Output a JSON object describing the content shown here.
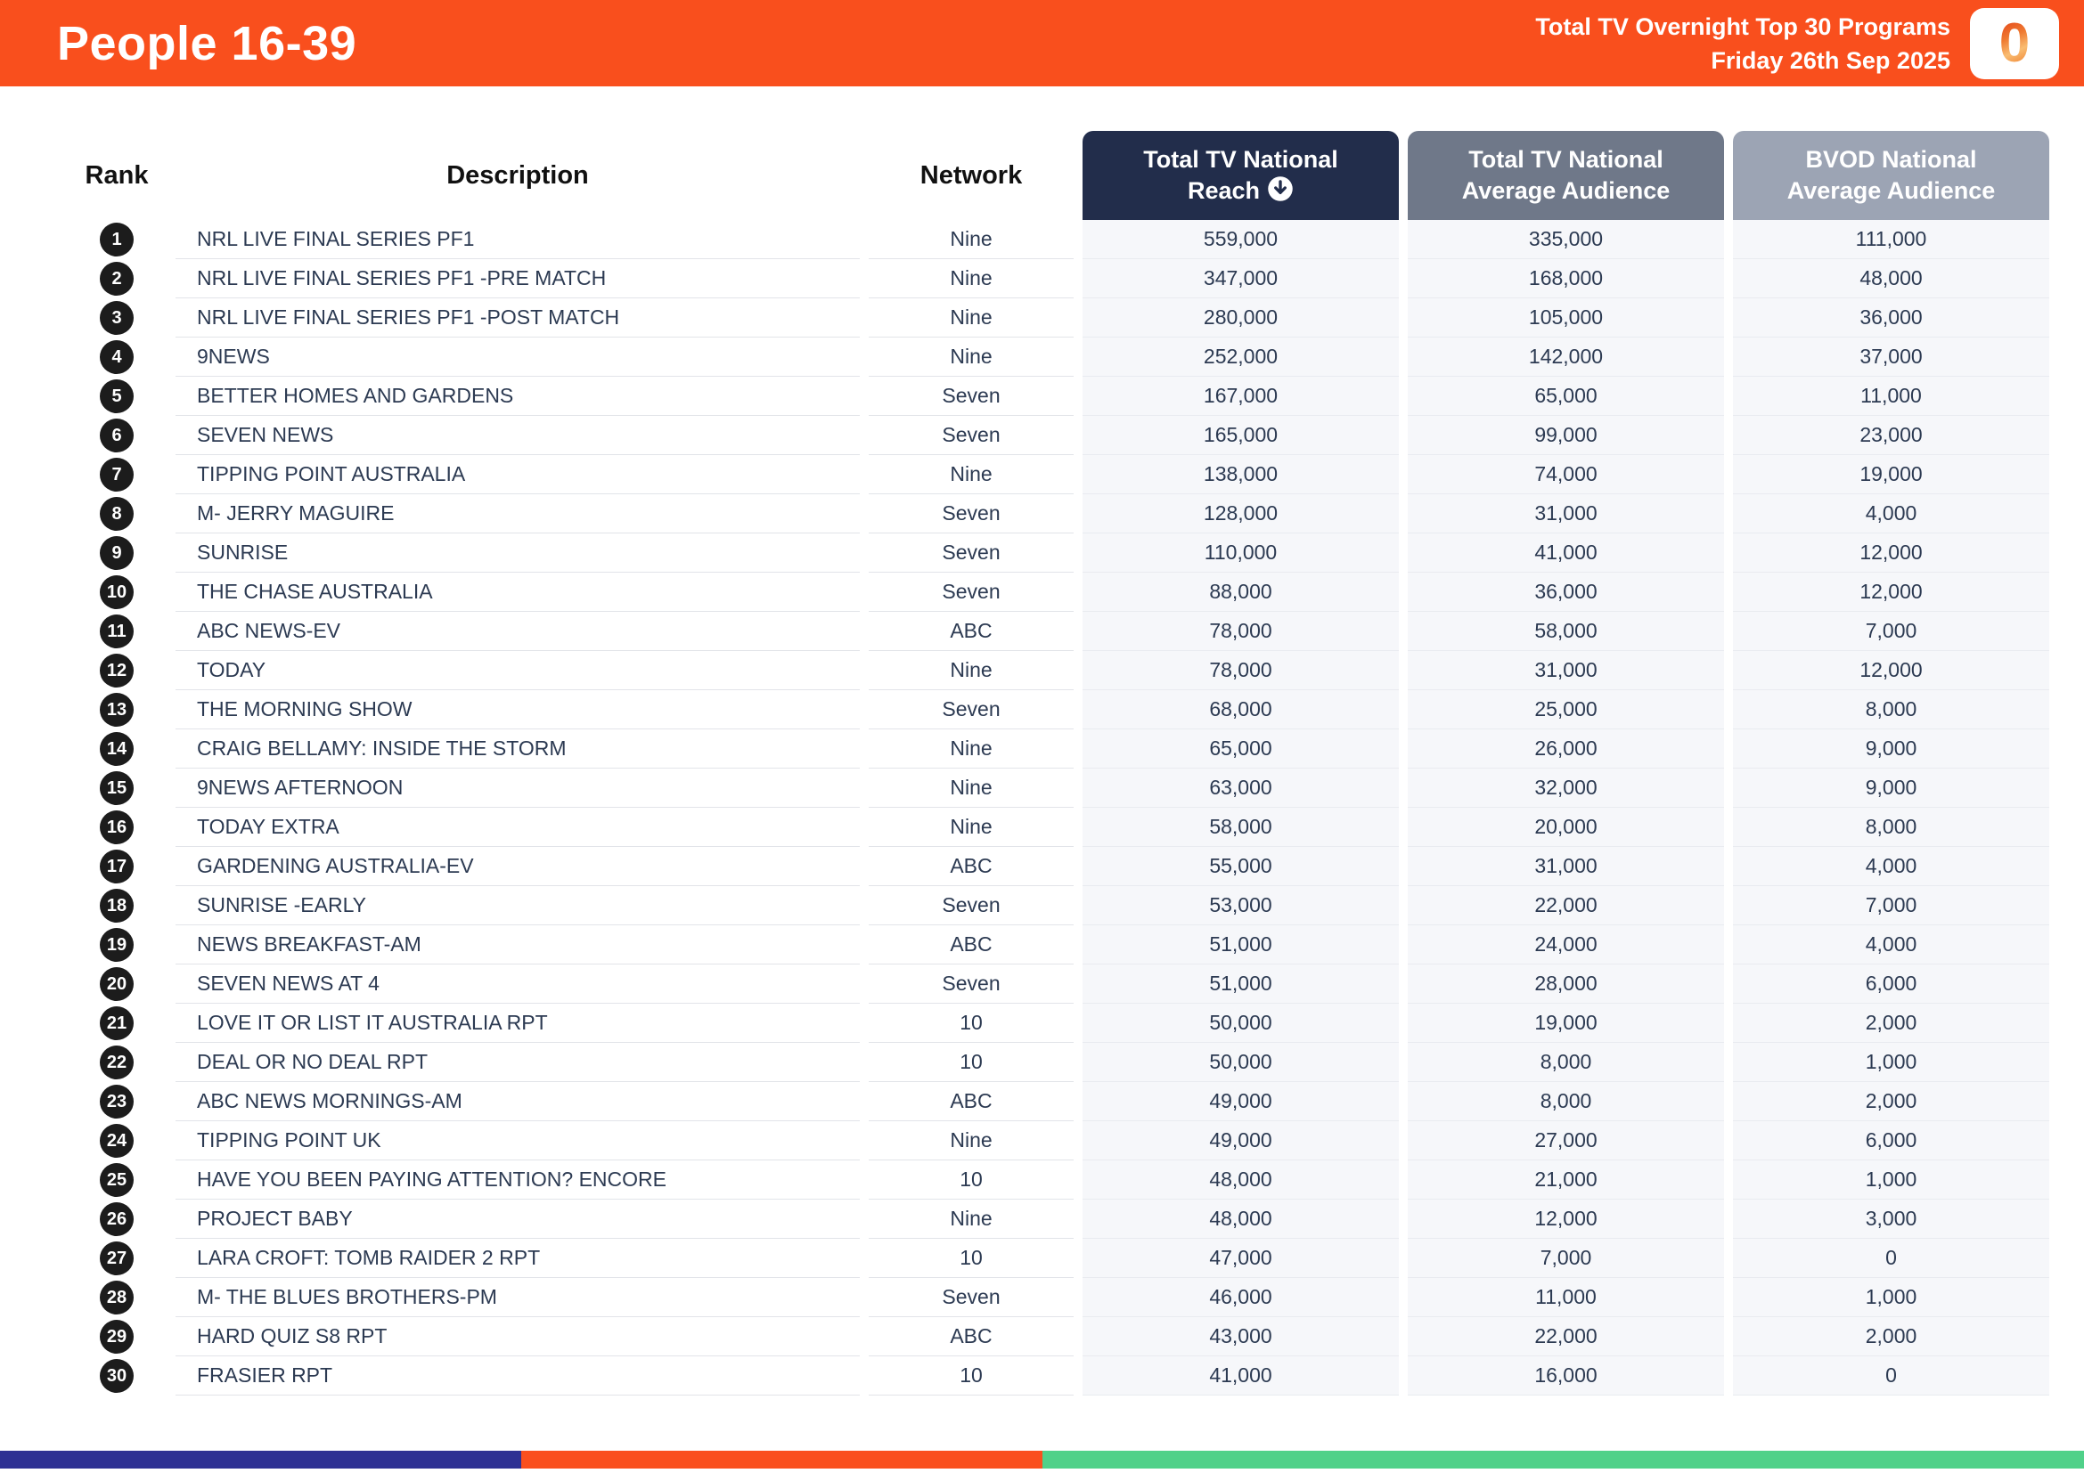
{
  "header": {
    "title": "People 16-39",
    "report_title": "Total TV Overnight Top 30 Programs",
    "report_date": "Friday 26th Sep 2025",
    "logo_glyph": "0",
    "banner_color": "#F94F1D"
  },
  "table": {
    "headers": {
      "rank": "Rank",
      "description": "Description",
      "network": "Network",
      "reach_line1": "Total TV National",
      "reach_line2": "Reach",
      "avg_line1": "Total TV National",
      "avg_line2": "Average Audience",
      "bvod_line1": "BVOD National",
      "bvod_line2": "Average Audience"
    },
    "header_colors": {
      "reach": "#222d4b",
      "avg": "#6f7889",
      "bvod": "#9ca4b4"
    },
    "sort_icon": "arrow-down-circle",
    "sorted_by": "Total TV National Reach",
    "rows": [
      {
        "rank": "1",
        "description": "NRL LIVE FINAL SERIES PF1",
        "network": "Nine",
        "reach": "559,000",
        "avg": "335,000",
        "bvod": "111,000"
      },
      {
        "rank": "2",
        "description": "NRL LIVE FINAL SERIES PF1 -PRE MATCH",
        "network": "Nine",
        "reach": "347,000",
        "avg": "168,000",
        "bvod": "48,000"
      },
      {
        "rank": "3",
        "description": "NRL LIVE FINAL SERIES PF1 -POST MATCH",
        "network": "Nine",
        "reach": "280,000",
        "avg": "105,000",
        "bvod": "36,000"
      },
      {
        "rank": "4",
        "description": "9NEWS",
        "network": "Nine",
        "reach": "252,000",
        "avg": "142,000",
        "bvod": "37,000"
      },
      {
        "rank": "5",
        "description": "BETTER HOMES AND GARDENS",
        "network": "Seven",
        "reach": "167,000",
        "avg": "65,000",
        "bvod": "11,000"
      },
      {
        "rank": "6",
        "description": "SEVEN NEWS",
        "network": "Seven",
        "reach": "165,000",
        "avg": "99,000",
        "bvod": "23,000"
      },
      {
        "rank": "7",
        "description": "TIPPING POINT AUSTRALIA",
        "network": "Nine",
        "reach": "138,000",
        "avg": "74,000",
        "bvod": "19,000"
      },
      {
        "rank": "8",
        "description": "M- JERRY MAGUIRE",
        "network": "Seven",
        "reach": "128,000",
        "avg": "31,000",
        "bvod": "4,000"
      },
      {
        "rank": "9",
        "description": "SUNRISE",
        "network": "Seven",
        "reach": "110,000",
        "avg": "41,000",
        "bvod": "12,000"
      },
      {
        "rank": "10",
        "description": "THE CHASE AUSTRALIA",
        "network": "Seven",
        "reach": "88,000",
        "avg": "36,000",
        "bvod": "12,000"
      },
      {
        "rank": "11",
        "description": "ABC NEWS-EV",
        "network": "ABC",
        "reach": "78,000",
        "avg": "58,000",
        "bvod": "7,000"
      },
      {
        "rank": "12",
        "description": "TODAY",
        "network": "Nine",
        "reach": "78,000",
        "avg": "31,000",
        "bvod": "12,000"
      },
      {
        "rank": "13",
        "description": "THE MORNING SHOW",
        "network": "Seven",
        "reach": "68,000",
        "avg": "25,000",
        "bvod": "8,000"
      },
      {
        "rank": "14",
        "description": "CRAIG BELLAMY: INSIDE THE STORM",
        "network": "Nine",
        "reach": "65,000",
        "avg": "26,000",
        "bvod": "9,000"
      },
      {
        "rank": "15",
        "description": "9NEWS AFTERNOON",
        "network": "Nine",
        "reach": "63,000",
        "avg": "32,000",
        "bvod": "9,000"
      },
      {
        "rank": "16",
        "description": "TODAY EXTRA",
        "network": "Nine",
        "reach": "58,000",
        "avg": "20,000",
        "bvod": "8,000"
      },
      {
        "rank": "17",
        "description": "GARDENING AUSTRALIA-EV",
        "network": "ABC",
        "reach": "55,000",
        "avg": "31,000",
        "bvod": "4,000"
      },
      {
        "rank": "18",
        "description": "SUNRISE -EARLY",
        "network": "Seven",
        "reach": "53,000",
        "avg": "22,000",
        "bvod": "7,000"
      },
      {
        "rank": "19",
        "description": "NEWS BREAKFAST-AM",
        "network": "ABC",
        "reach": "51,000",
        "avg": "24,000",
        "bvod": "4,000"
      },
      {
        "rank": "20",
        "description": "SEVEN NEWS AT 4",
        "network": "Seven",
        "reach": "51,000",
        "avg": "28,000",
        "bvod": "6,000"
      },
      {
        "rank": "21",
        "description": "LOVE IT OR LIST IT AUSTRALIA RPT",
        "network": "10",
        "reach": "50,000",
        "avg": "19,000",
        "bvod": "2,000"
      },
      {
        "rank": "22",
        "description": "DEAL OR NO DEAL RPT",
        "network": "10",
        "reach": "50,000",
        "avg": "8,000",
        "bvod": "1,000"
      },
      {
        "rank": "23",
        "description": "ABC NEWS MORNINGS-AM",
        "network": "ABC",
        "reach": "49,000",
        "avg": "8,000",
        "bvod": "2,000"
      },
      {
        "rank": "24",
        "description": "TIPPING POINT UK",
        "network": "Nine",
        "reach": "49,000",
        "avg": "27,000",
        "bvod": "6,000"
      },
      {
        "rank": "25",
        "description": "HAVE YOU BEEN PAYING ATTENTION? ENCORE",
        "network": "10",
        "reach": "48,000",
        "avg": "21,000",
        "bvod": "1,000"
      },
      {
        "rank": "26",
        "description": "PROJECT BABY",
        "network": "Nine",
        "reach": "48,000",
        "avg": "12,000",
        "bvod": "3,000"
      },
      {
        "rank": "27",
        "description": "LARA CROFT: TOMB RAIDER 2 RPT",
        "network": "10",
        "reach": "47,000",
        "avg": "7,000",
        "bvod": "0"
      },
      {
        "rank": "28",
        "description": "M- THE BLUES BROTHERS-PM",
        "network": "Seven",
        "reach": "46,000",
        "avg": "11,000",
        "bvod": "1,000"
      },
      {
        "rank": "29",
        "description": "HARD QUIZ S8 RPT",
        "network": "ABC",
        "reach": "43,000",
        "avg": "22,000",
        "bvod": "2,000"
      },
      {
        "rank": "30",
        "description": "FRASIER RPT",
        "network": "10",
        "reach": "41,000",
        "avg": "16,000",
        "bvod": "0"
      }
    ]
  },
  "footer_bar": {
    "blue": "#2e3193",
    "orange": "#fa4f1e",
    "green": "#50d189"
  }
}
